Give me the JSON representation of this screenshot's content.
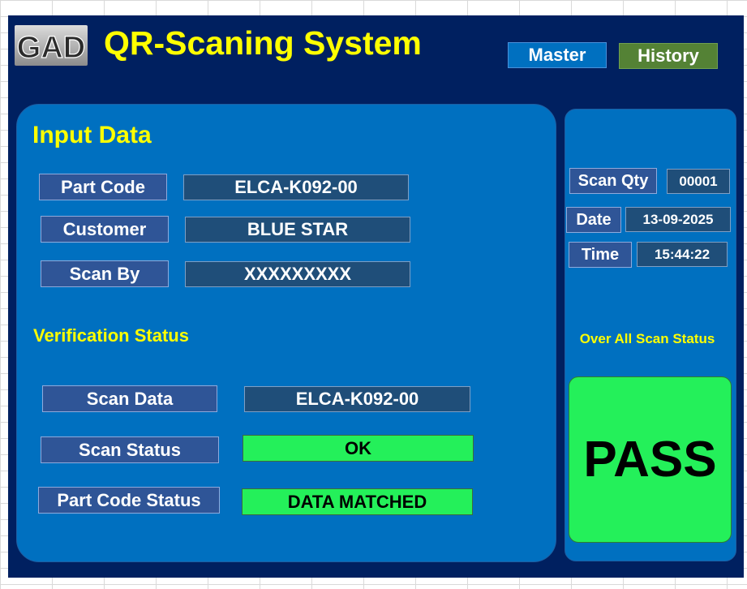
{
  "header": {
    "logo_text": "GAD",
    "title": "QR-Scaning System",
    "master_label": "Master",
    "history_label": "History"
  },
  "input_section": {
    "heading": "Input Data",
    "fields": [
      {
        "label": "Part Code",
        "value": "ELCA-K092-00"
      },
      {
        "label": "Customer",
        "value": "BLUE STAR"
      },
      {
        "label": "Scan By",
        "value": "XXXXXXXXX"
      }
    ]
  },
  "verification_section": {
    "heading": "Verification Status",
    "fields": [
      {
        "label": "Scan Data",
        "value": "ELCA-K092-00"
      },
      {
        "label": "Scan Status",
        "value": "OK"
      },
      {
        "label": "Part Code  Status",
        "value": "DATA MATCHED"
      }
    ]
  },
  "side_panel": {
    "scan_qty_label": "Scan Qty",
    "scan_qty_value": "00001",
    "date_label": "Date",
    "date_value": "13-09-2025",
    "time_label": "Time",
    "time_value": "15:44:22",
    "overall_label": "Over All Scan Status",
    "overall_value": "PASS"
  },
  "colors": {
    "background": "#002060",
    "panel": "#0070c0",
    "heading": "#ffff00",
    "label_box": "#2f5597",
    "value_box": "#1f4e79",
    "status_ok": "#24f05a",
    "master_button": "#0070c0",
    "history_button": "#548235"
  }
}
